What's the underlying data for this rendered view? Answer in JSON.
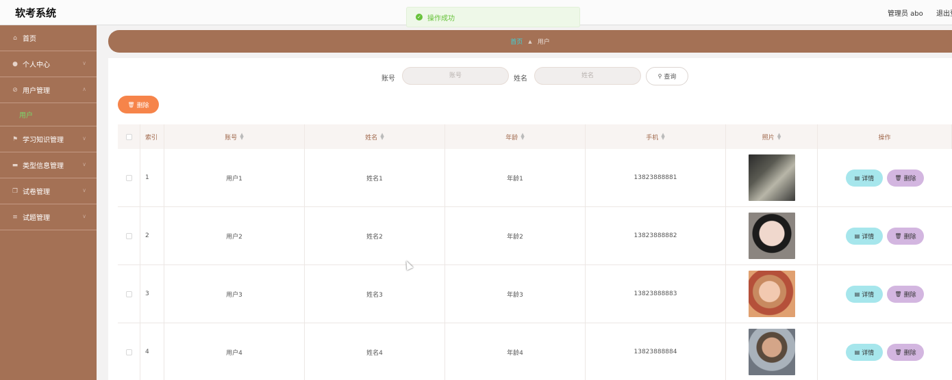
{
  "header": {
    "app_title": "软考系统",
    "user_label": "管理员 abo",
    "logout_label": "退出登录"
  },
  "toast": {
    "icon": "check-circle-icon",
    "message": "操作成功",
    "color": "#67c23a"
  },
  "sidebar": {
    "items": [
      {
        "label": "首页",
        "icon": "home-icon"
      },
      {
        "label": "个人中心",
        "icon": "user-icon"
      },
      {
        "label": "用户管理",
        "icon": "users-icon"
      },
      {
        "label": "学习知识管理",
        "icon": "flag-icon"
      },
      {
        "label": "类型信息管理",
        "icon": "monitor-icon"
      },
      {
        "label": "试卷管理",
        "icon": "copy-icon"
      },
      {
        "label": "试题管理",
        "icon": "list-icon"
      }
    ],
    "sub_item": {
      "label": "用户"
    }
  },
  "breadcrumb": {
    "home": "首页",
    "current": "用户"
  },
  "search": {
    "account_label": "账号",
    "account_placeholder": "账号",
    "name_label": "姓名",
    "name_placeholder": "姓名",
    "query_button": "查询"
  },
  "actions": {
    "delete_label": "删除"
  },
  "table": {
    "columns": [
      "索引",
      "账号",
      "姓名",
      "年龄",
      "手机",
      "照片",
      "操作"
    ],
    "rows": [
      {
        "index": "1",
        "account": "用户1",
        "name": "姓名1",
        "age": "年龄1",
        "phone": "13823888881"
      },
      {
        "index": "2",
        "account": "用户2",
        "name": "姓名2",
        "age": "年龄2",
        "phone": "13823888882"
      },
      {
        "index": "3",
        "account": "用户3",
        "name": "姓名3",
        "age": "年龄3",
        "phone": "13823888883"
      },
      {
        "index": "4",
        "account": "用户4",
        "name": "姓名4",
        "age": "年龄4",
        "phone": "13823888884"
      }
    ],
    "detail_label": "详情",
    "delete_label": "删除"
  },
  "colors": {
    "brand": "#a47155",
    "accent": "#3fd0d6",
    "delete_btn": "#f6844a"
  }
}
